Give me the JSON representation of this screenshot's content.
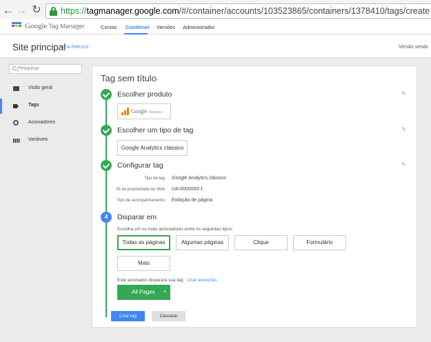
{
  "browser": {
    "url_scheme": "https://",
    "url_host": "tagmanager.google.com",
    "url_path": "/#/container/accounts/103523865/containers/1378410/tags/create"
  },
  "header": {
    "brand_google": "Google",
    "brand_product": "Tag Manager",
    "nav": [
      "Contas",
      "Contêiner",
      "Versões",
      "Administrador"
    ],
    "active_nav": "Contêiner",
    "logo_colors": [
      "#4285f4",
      "#ea4335",
      "#fbbc05",
      "#34a853"
    ]
  },
  "site": {
    "name": "Site principal",
    "container_id": "GTM-PWKZC6",
    "version_text": "Versão sendo"
  },
  "sidebar": {
    "search_placeholder": "Pesquisar",
    "items": [
      {
        "label": "Visão geral",
        "icon": "briefcase-icon"
      },
      {
        "label": "Tags",
        "icon": "tag-icon",
        "active": true
      },
      {
        "label": "Acionadores",
        "icon": "trigger-icon"
      },
      {
        "label": "Variáveis",
        "icon": "variables-icon"
      }
    ]
  },
  "editor": {
    "title": "Tag sem título",
    "steps": {
      "product": {
        "title": "Escolher produto",
        "product_name": "Google",
        "product_suffix": "Analytics"
      },
      "tag_type": {
        "title": "Escolher um tipo de tag",
        "value": "Google Analytics clássico"
      },
      "configure": {
        "title": "Configurar tag",
        "rows": [
          {
            "label": "Tipo de tag",
            "value": "Google Analytics clássico"
          },
          {
            "label": "ID da propriedade da Web",
            "value": "UA-0000000-1"
          },
          {
            "label": "Tipo de acompanhamento",
            "value": "Exibição de página"
          }
        ]
      },
      "fire": {
        "number": "4",
        "title": "Disparar em",
        "caption": "Escolha um ou mais acionadores entre os seguintes tipos:",
        "options": [
          "Todas as páginas",
          "Algumas páginas",
          "Clique",
          "Formulário",
          "Mais"
        ],
        "selected_option": "Todas as páginas",
        "fires_on_label": "Este acionador disparará sua tag:",
        "create_exceptions": "Criar exceções",
        "selected_trigger": "All Pages",
        "remove_glyph": "×"
      }
    },
    "colors": {
      "complete": "#34a853",
      "current": "#4285f4"
    }
  },
  "actions": {
    "create": "Criar tag",
    "cancel": "Cancelar"
  }
}
